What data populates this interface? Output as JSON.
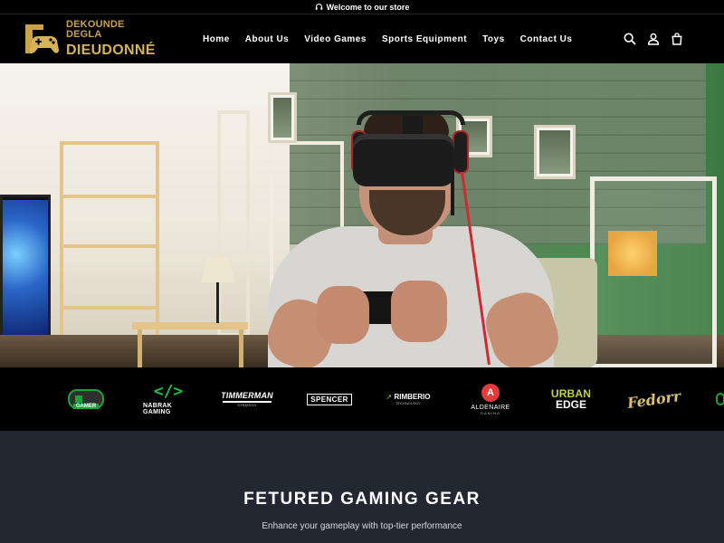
{
  "announcement": {
    "icon": "headphones-icon",
    "text": "Welcome to our store"
  },
  "header": {
    "logo": {
      "line1": "DEKOUNDE DEGLA",
      "line2": "DIEUDONNÉ"
    },
    "nav": [
      {
        "label": "Home"
      },
      {
        "label": "About Us"
      },
      {
        "label": "Video Games"
      },
      {
        "label": "Sports Equipment"
      },
      {
        "label": "Toys"
      },
      {
        "label": "Contact Us"
      }
    ],
    "icons": [
      "search-icon",
      "account-icon",
      "cart-icon"
    ]
  },
  "hero": {
    "image": "man-playing-vr-headset-with-controller"
  },
  "brands": {
    "gamer": {
      "label": "GAMER"
    },
    "nabrak": {
      "mark": "</>",
      "label": "NABRAK GAMING"
    },
    "timmerman": {
      "label": "TIMMERMAN",
      "sub": "STRATEGY"
    },
    "spencer": {
      "label": "SPENCER"
    },
    "rimberio": {
      "label": "RIMBERIO",
      "sub": "TECHNOLOGY"
    },
    "aldenaire": {
      "mark": "A",
      "label": "ALDENAIRE",
      "sub": "GAMING"
    },
    "urban_edge": {
      "line1": "URBAN",
      "line2": "EDGE"
    },
    "fedor": {
      "label": "Fedorr"
    }
  },
  "featured": {
    "title": "FETURED GAMING GEAR",
    "subtitle": "Enhance your gameplay with top-tier performance"
  },
  "colors": {
    "accent_gold": "#d8b257",
    "brand_green": "#1fc04a",
    "section_bg": "#232732"
  }
}
